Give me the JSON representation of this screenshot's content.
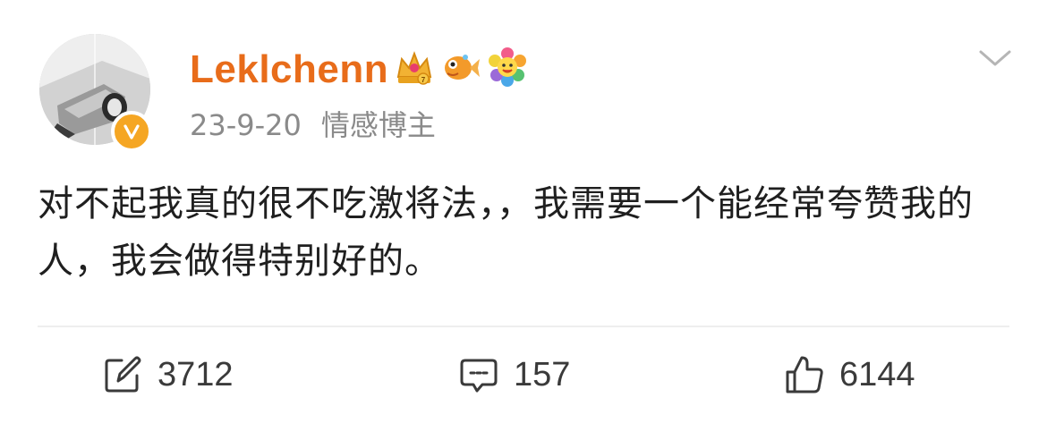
{
  "post": {
    "username": "Leklchenn",
    "date": "23-9-20",
    "user_tag": "情感博主",
    "content": "对不起我真的很不吃激将法，，我需要一个能经常夸赞我的人，我会做得特别好的。",
    "icons": {
      "avatar": "avatar-image",
      "verified": "verified-badge-icon",
      "badges": [
        "crown-level-badge-icon",
        "fish-badge-icon",
        "flower-badge-icon"
      ],
      "menu": "chevron-down-icon"
    },
    "colors": {
      "username": "#e86c1a",
      "verified": "#f5a623",
      "meta": "#8a8a8a"
    }
  },
  "actions": {
    "repost_count": "3712",
    "comment_count": "157",
    "like_count": "6144"
  }
}
